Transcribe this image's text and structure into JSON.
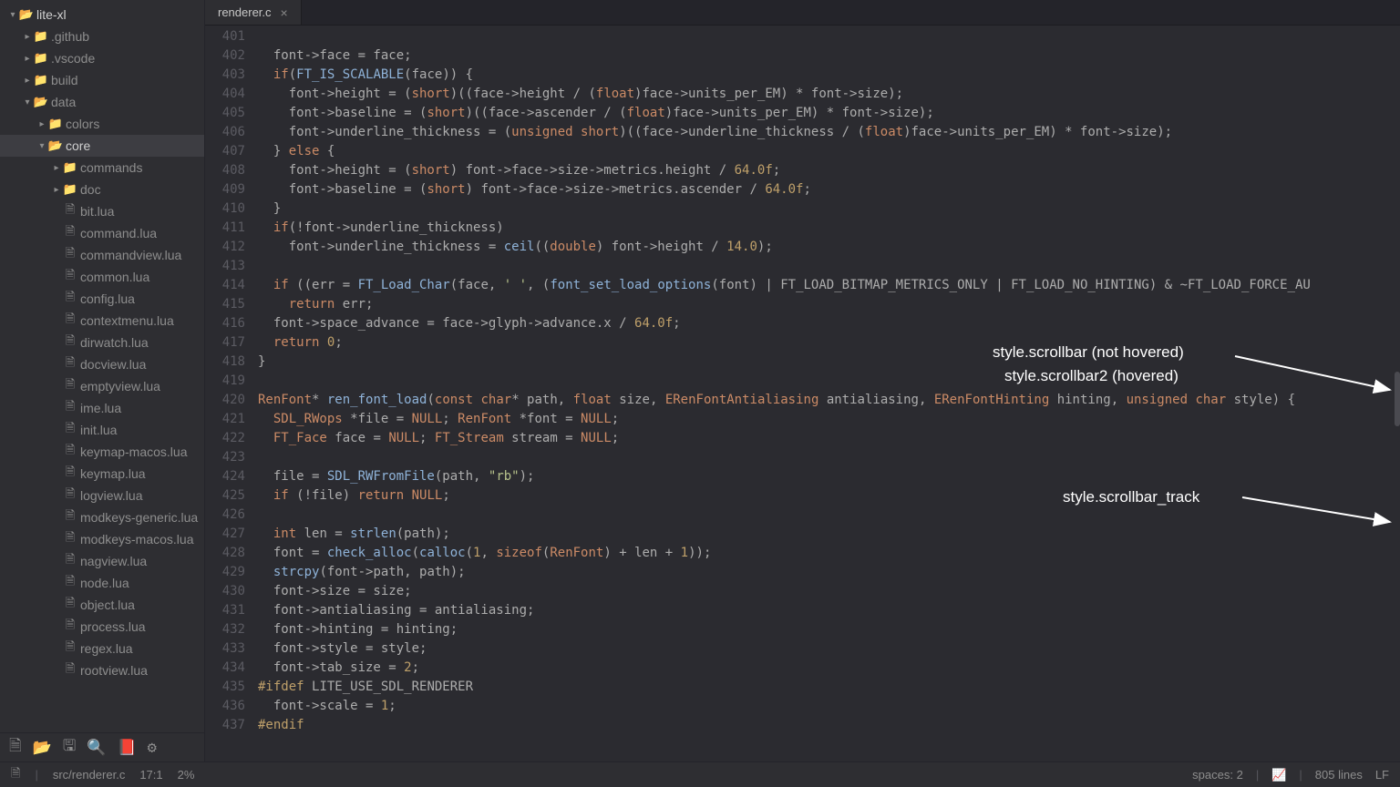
{
  "project": {
    "root": "lite-xl",
    "tree": [
      {
        "depth": 0,
        "label": "lite-xl",
        "type": "folder-open",
        "chev": "down",
        "root": true
      },
      {
        "depth": 1,
        "label": ".github",
        "type": "folder",
        "chev": "right"
      },
      {
        "depth": 1,
        "label": ".vscode",
        "type": "folder",
        "chev": "right"
      },
      {
        "depth": 1,
        "label": "build",
        "type": "folder",
        "chev": "right"
      },
      {
        "depth": 1,
        "label": "data",
        "type": "folder-open",
        "chev": "down"
      },
      {
        "depth": 2,
        "label": "colors",
        "type": "folder",
        "chev": "right"
      },
      {
        "depth": 2,
        "label": "core",
        "type": "folder-open",
        "chev": "down",
        "selected": true
      },
      {
        "depth": 3,
        "label": "commands",
        "type": "folder",
        "chev": "right"
      },
      {
        "depth": 3,
        "label": "doc",
        "type": "folder",
        "chev": "right"
      },
      {
        "depth": 3,
        "label": "bit.lua",
        "type": "file"
      },
      {
        "depth": 3,
        "label": "command.lua",
        "type": "file"
      },
      {
        "depth": 3,
        "label": "commandview.lua",
        "type": "file"
      },
      {
        "depth": 3,
        "label": "common.lua",
        "type": "file"
      },
      {
        "depth": 3,
        "label": "config.lua",
        "type": "file"
      },
      {
        "depth": 3,
        "label": "contextmenu.lua",
        "type": "file"
      },
      {
        "depth": 3,
        "label": "dirwatch.lua",
        "type": "file"
      },
      {
        "depth": 3,
        "label": "docview.lua",
        "type": "file"
      },
      {
        "depth": 3,
        "label": "emptyview.lua",
        "type": "file"
      },
      {
        "depth": 3,
        "label": "ime.lua",
        "type": "file"
      },
      {
        "depth": 3,
        "label": "init.lua",
        "type": "file"
      },
      {
        "depth": 3,
        "label": "keymap-macos.lua",
        "type": "file"
      },
      {
        "depth": 3,
        "label": "keymap.lua",
        "type": "file"
      },
      {
        "depth": 3,
        "label": "logview.lua",
        "type": "file"
      },
      {
        "depth": 3,
        "label": "modkeys-generic.lua",
        "type": "file"
      },
      {
        "depth": 3,
        "label": "modkeys-macos.lua",
        "type": "file"
      },
      {
        "depth": 3,
        "label": "nagview.lua",
        "type": "file"
      },
      {
        "depth": 3,
        "label": "node.lua",
        "type": "file"
      },
      {
        "depth": 3,
        "label": "object.lua",
        "type": "file"
      },
      {
        "depth": 3,
        "label": "process.lua",
        "type": "file"
      },
      {
        "depth": 3,
        "label": "regex.lua",
        "type": "file"
      },
      {
        "depth": 3,
        "label": "rootview.lua",
        "type": "file"
      }
    ]
  },
  "tabs": [
    {
      "label": "renderer.c",
      "active": true
    }
  ],
  "code": {
    "first_line": 401,
    "lines": [
      "",
      "  font->face = face;",
      "  if(FT_IS_SCALABLE(face)) {",
      "    font->height = (short)((face->height / (float)face->units_per_EM) * font->size);",
      "    font->baseline = (short)((face->ascender / (float)face->units_per_EM) * font->size);",
      "    font->underline_thickness = (unsigned short)((face->underline_thickness / (float)face->units_per_EM) * font->size);",
      "  } else {",
      "    font->height = (short) font->face->size->metrics.height / 64.0f;",
      "    font->baseline = (short) font->face->size->metrics.ascender / 64.0f;",
      "  }",
      "  if(!font->underline_thickness)",
      "    font->underline_thickness = ceil((double) font->height / 14.0);",
      "",
      "  if ((err = FT_Load_Char(face, ' ', (font_set_load_options(font) | FT_LOAD_BITMAP_METRICS_ONLY | FT_LOAD_NO_HINTING) & ~FT_LOAD_FORCE_AU",
      "    return err;",
      "  font->space_advance = face->glyph->advance.x / 64.0f;",
      "  return 0;",
      "}",
      "",
      "RenFont* ren_font_load(const char* path, float size, ERenFontAntialiasing antialiasing, ERenFontHinting hinting, unsigned char style) {",
      "  SDL_RWops *file = NULL; RenFont *font = NULL;",
      "  FT_Face face = NULL; FT_Stream stream = NULL;",
      "",
      "  file = SDL_RWFromFile(path, \"rb\");",
      "  if (!file) return NULL;",
      "",
      "  int len = strlen(path);",
      "  font = check_alloc(calloc(1, sizeof(RenFont) + len + 1));",
      "  strcpy(font->path, path);",
      "  font->size = size;",
      "  font->antialiasing = antialiasing;",
      "  font->hinting = hinting;",
      "  font->style = style;",
      "  font->tab_size = 2;",
      "#ifdef LITE_USE_SDL_RENDERER",
      "  font->scale = 1;",
      "#endif"
    ]
  },
  "annotations": {
    "a1": "style.scrollbar (not hovered)",
    "a2": "style.scrollbar2 (hovered)",
    "a3": "style.scrollbar_track"
  },
  "toolbar": {
    "new_file": "🗎",
    "open_folder": "📂",
    "save": "🖫",
    "search": "🔍",
    "book": "📕",
    "settings": "⚙"
  },
  "status": {
    "file_icon": "🗎",
    "path": "src/renderer.c",
    "cursor": "17:1",
    "percent": "2%",
    "spaces": "spaces: 2",
    "graph_icon": "📈",
    "lines": "805 lines",
    "eol": "LF"
  }
}
